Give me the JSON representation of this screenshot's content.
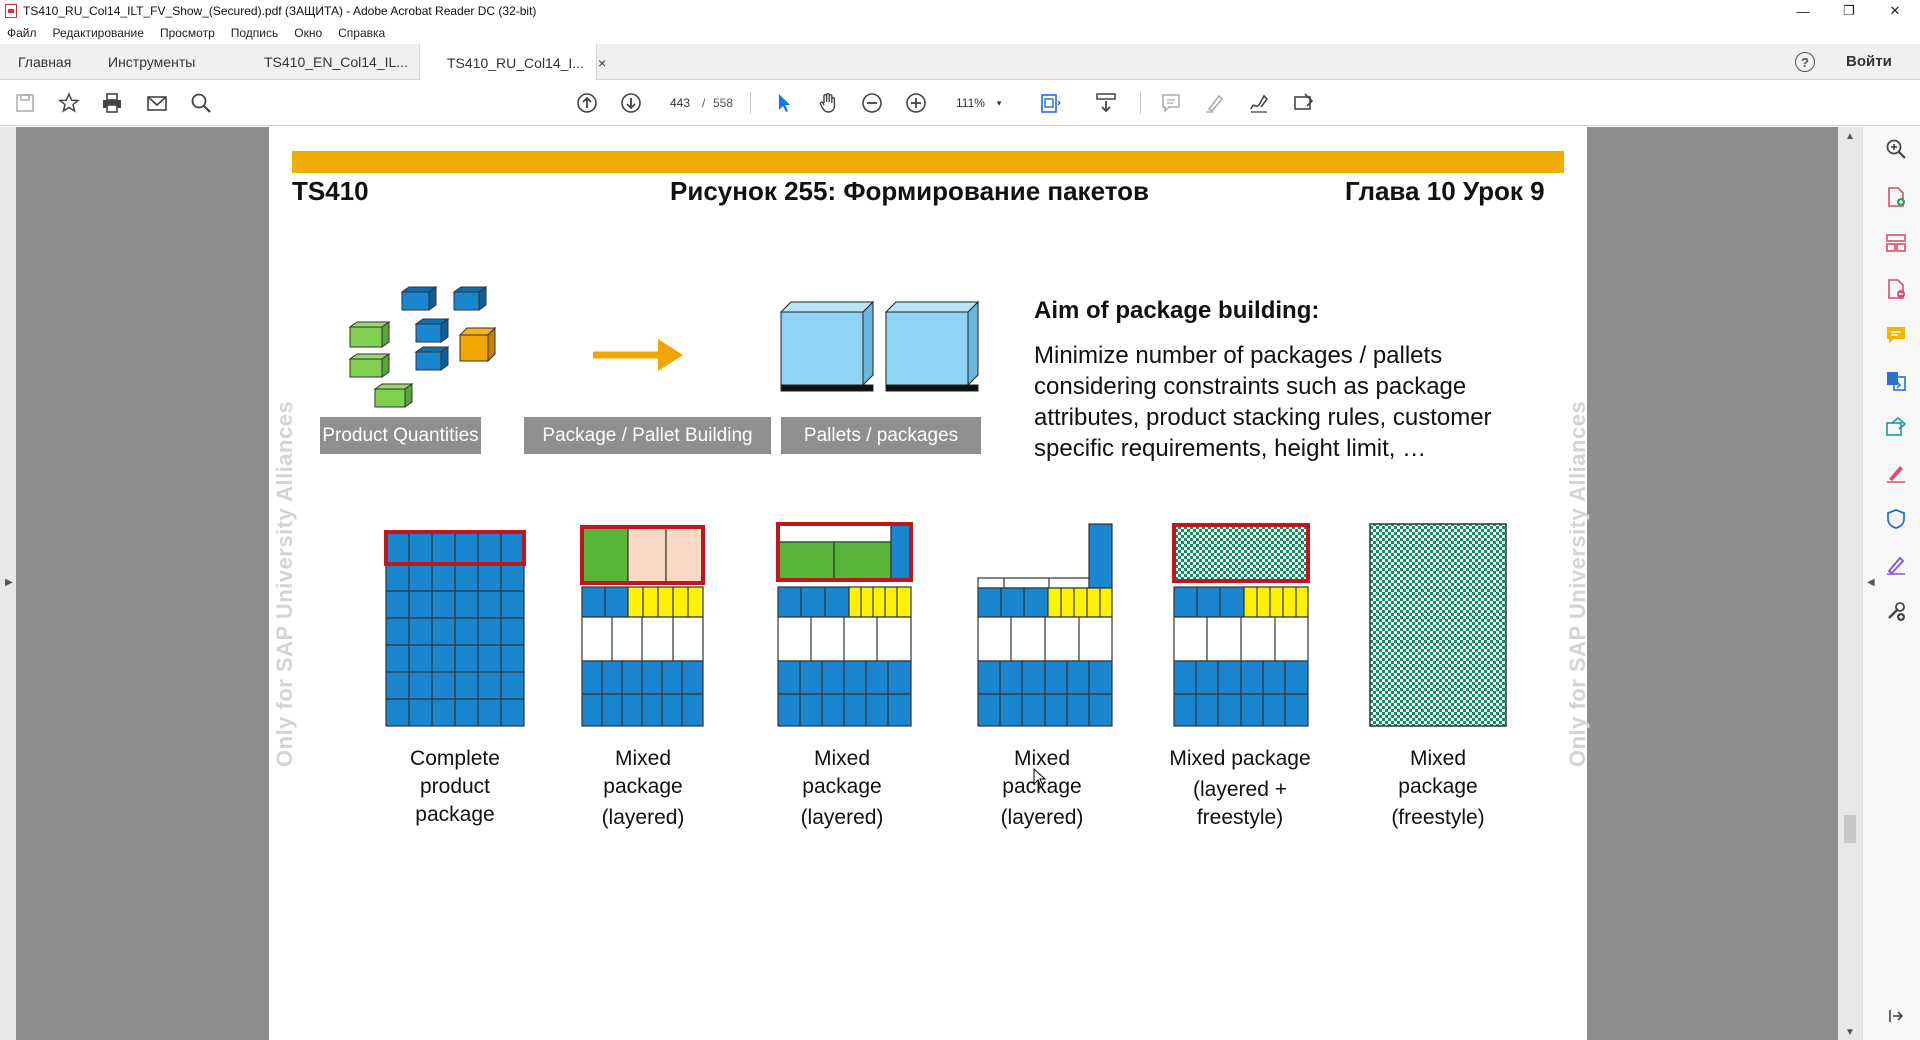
{
  "window": {
    "title": "TS410_RU_Col14_ILT_FV_Show_(Secured).pdf (ЗАЩИТА) - Adobe Acrobat Reader DC (32-bit)",
    "minimize": "—",
    "maximize": "❐",
    "close": "✕"
  },
  "menu": [
    "Файл",
    "Редактирование",
    "Просмотр",
    "Подпись",
    "Окно",
    "Справка"
  ],
  "tabs": {
    "home": "Главная",
    "tools": "Инструменты",
    "doc1": "TS410_EN_Col14_IL...",
    "doc2": "TS410_RU_Col14_I...",
    "close": "×",
    "help": "?",
    "signin": "Войти"
  },
  "toolbar": {
    "current_page": "443",
    "page_sep": "/",
    "total_pages": "558",
    "zoom": "111%",
    "zoom_caret": "▾"
  },
  "document": {
    "header_left": "TS410",
    "header_center": "Рисунок 255: Формирование пакетов",
    "header_right": "Глава 10 Урок 9",
    "watermark": "Only for SAP University Alliances",
    "labels": [
      "Product Quantities",
      "Package / Pallet Building",
      "Pallets / packages"
    ],
    "aim_title": "Aim of package building:",
    "aim_body": "Minimize number of packages / pallets considering constraints such as package attributes, product stacking rules, customer specific requirements, height limit, …",
    "captions": [
      [
        "Complete",
        "product",
        "package"
      ],
      [
        "Mixed",
        "package",
        "(layered)"
      ],
      [
        "Mixed",
        "package",
        "(layered)"
      ],
      [
        "Mixed",
        "package",
        "(layered)"
      ],
      [
        "Mixed  package",
        "(layered +",
        "freestyle)"
      ],
      [
        "Mixed",
        "package",
        "(freestyle)"
      ]
    ]
  },
  "colors": {
    "accent_orange": "#f0ab00",
    "box_blue": "#1a86cf",
    "box_green": "#58b53a",
    "box_yellow": "#fff200",
    "frame_red": "#c0161e",
    "pattern_green": "#0f8f5f"
  },
  "icons": {
    "left_toolbar": [
      "save-icon",
      "star-icon",
      "print-icon",
      "mail-icon",
      "search-icon"
    ],
    "center_toolbar": [
      "page-up-icon",
      "page-down-icon",
      "select-cursor-icon",
      "hand-icon",
      "zoom-out-icon",
      "zoom-in-icon",
      "fit-page-icon",
      "scroll-mode-icon",
      "comment-icon",
      "highlight-icon",
      "sign-icon",
      "read-mode-icon"
    ],
    "right_pane": [
      "zoom-tool-icon",
      "create-pdf-icon",
      "organize-icon",
      "export-pdf-icon",
      "comment-tool-icon",
      "combine-icon",
      "send-icon",
      "fill-sign-icon",
      "protect-icon",
      "pen-icon",
      "more-tools-icon"
    ]
  }
}
